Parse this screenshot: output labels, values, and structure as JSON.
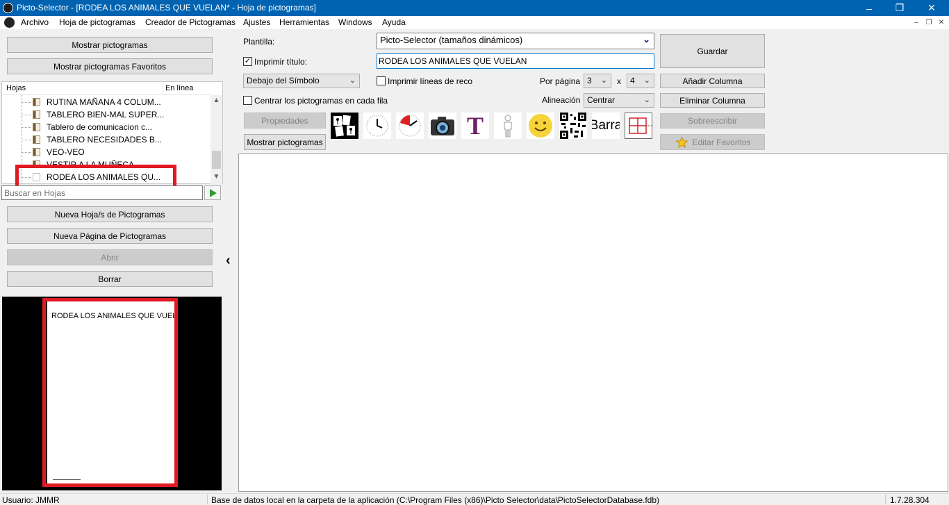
{
  "window": {
    "title": "Picto-Selector - [RODEA LOS ANIMALES QUE VUELAN* - Hoja de pictogramas]",
    "minimize": "–",
    "restore": "❐",
    "close": "✕"
  },
  "menu": {
    "items": [
      "Archivo",
      "Hoja de pictogramas",
      "Creador de Pictogramas",
      "Ajustes",
      "Herramientas",
      "Windows",
      "Ayuda"
    ],
    "mdi_minimize": "–",
    "mdi_restore": "❐",
    "mdi_close": "✕"
  },
  "left": {
    "show_pictos": "Mostrar pictogramas",
    "show_favorites": "Mostrar pictogramas Favoritos",
    "tree_headers": {
      "sheets": "Hojas",
      "online": "En línea"
    },
    "tree_items": [
      "RUTINA MAÑANA 4 COLUM...",
      "TABLERO BIEN-MAL SUPER...",
      "Tablero de comunicacion c...",
      "TABLERO NECESIDADES B...",
      "VEO-VEO",
      "VESTIR A LA MUÑECA",
      "RODEA LOS ANIMALES QU..."
    ],
    "search_placeholder": "Buscar en Hojas",
    "new_sheet": "Nueva Hoja/s de Pictogramas",
    "new_page": "Nueva Página de Pictogramas",
    "open": "Abrir",
    "delete": "Borrar",
    "preview_title": "RODEA LOS ANIMALES QUE VUELAN"
  },
  "toolbar": {
    "template_label": "Plantilla:",
    "template_value": "Picto-Selector (tamaños dinámicos)",
    "print_title_label": "Imprimir título:",
    "print_title_checked": "✓",
    "title_value": "RODEA LOS ANIMALES QUE VUELAN",
    "text_position": "Debajo del Símbolo",
    "print_lines_label": "Imprimir líneas de reco",
    "per_page_label": "Por página",
    "per_page_cols": "3",
    "per_page_x": "x",
    "per_page_rows": "4",
    "center_label": "Centrar los pictogramas en cada fila",
    "alignment_label": "Alineación",
    "alignment_value": "Centrar",
    "properties": "Propiedades",
    "show_pictos": "Mostrar pictogramas",
    "barra_label": "Barra",
    "t_label": "T",
    "save": "Guardar",
    "add_column": "Añadir Columna",
    "remove_column": "Eliminar Columna",
    "overwrite": "Sobreescribir",
    "edit_favorites": "Editar Favoritos"
  },
  "status": {
    "user": "Usuario: JMMR",
    "db": "Base de datos local en la carpeta de la aplicación (C:\\Program Files (x86)\\Picto Selector\\data\\PictoSelectorDatabase.fdb)",
    "version": "1.7.28.304"
  }
}
